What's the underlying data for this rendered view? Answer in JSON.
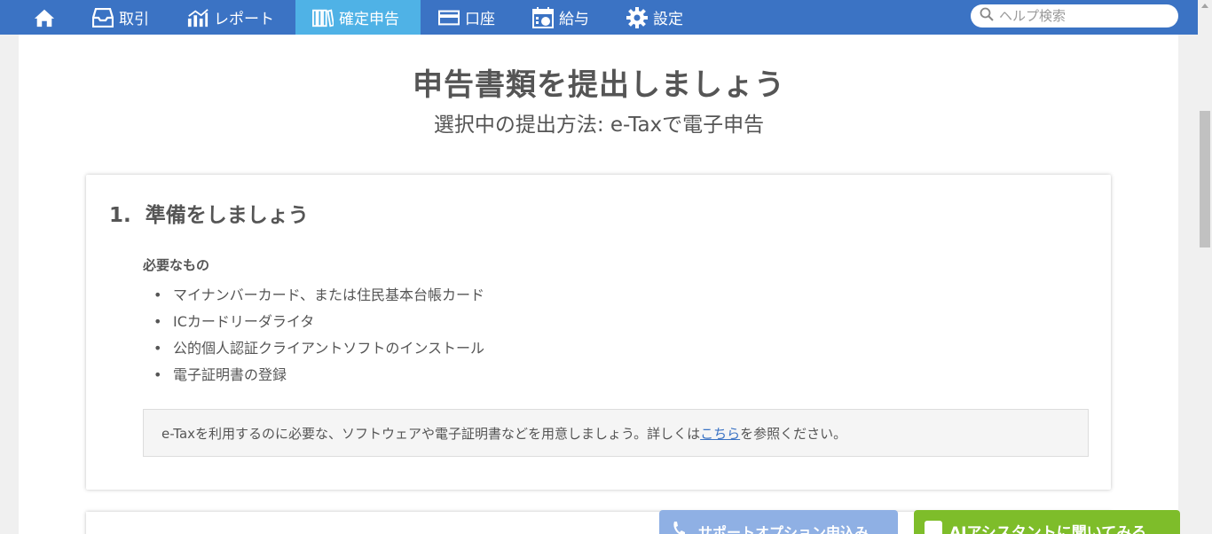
{
  "nav": {
    "items": [
      {
        "label": "",
        "icon": "home-icon"
      },
      {
        "label": "取引",
        "icon": "inbox-icon"
      },
      {
        "label": "レポート",
        "icon": "chart-icon"
      },
      {
        "label": "確定申告",
        "icon": "books-icon"
      },
      {
        "label": "口座",
        "icon": "card-icon"
      },
      {
        "label": "給与",
        "icon": "calendar-icon"
      },
      {
        "label": "設定",
        "icon": "gear-icon"
      }
    ],
    "search_placeholder": "ヘルプ検索",
    "active_color": "#4fb2e6",
    "bar_color": "#3b73c4"
  },
  "header": {
    "title": "申告書類を提出しましょう",
    "subtitle": "選択中の提出方法: e-Taxで電子申告"
  },
  "section1": {
    "title": "1.  準備をしましょう",
    "requirements_heading": "必要なもの",
    "requirements": [
      "マイナンバーカード、または住民基本台帳カード",
      "ICカードリーダライタ",
      "公的個人認証クライアントソフトのインストール",
      "電子証明書の登録"
    ],
    "note_before": "e-Taxを利用するのに必要な、ソフトウェアや電子証明書などを用意しましょう。詳しくは",
    "note_link": "こちら",
    "note_after": "を参照ください。"
  },
  "floating": {
    "support_label": "サポートオプション申込み",
    "ai_label": "AIアシスタントに聞いてみる"
  }
}
